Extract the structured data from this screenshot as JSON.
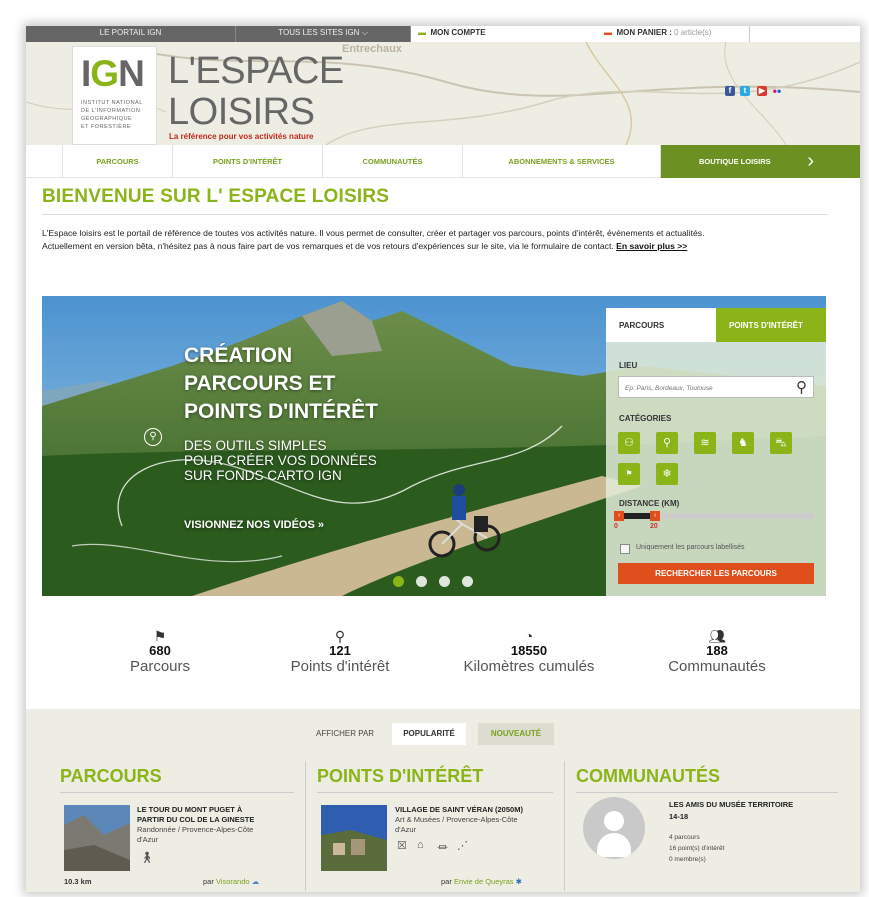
{
  "topbar": {
    "portail": "LE PORTAIL IGN",
    "sites": "TOUS LES SITES IGN",
    "compte": "MON COMPTE",
    "panier_label": "MON PANIER :",
    "panier_count": "0 article(s)"
  },
  "header": {
    "ign": "IGN",
    "institut": [
      "INSTITUT NATIONAL",
      "DE L'INFORMATION",
      "GÉOGRAPHIQUE",
      "ET FORESTIÈRE"
    ],
    "title_line1": "L'ESPACE",
    "title_line2": "LOISIRS",
    "tagline": "La référence pour vos activités nature",
    "map_place": "Entrechaux"
  },
  "nav": {
    "items": [
      "PARCOURS",
      "POINTS D'INTÉRÊT",
      "COMMUNAUTÉS",
      "ABONNEMENTS & SERVICES"
    ],
    "shop": "BOUTIQUE LOISIRS"
  },
  "welcome": "BIENVENUE SUR L' ESPACE LOISIRS",
  "intro": {
    "line1": "L'Espace loisirs est le portail de référence de toutes vos activités nature. Il vous permet de consulter, créer et partager vos parcours, points d'intérêt, événements et actualités.",
    "line2": "Actuellement en version bêta, n'hésitez pas à nous faire part de vos remarques et de vos retours d'expériences sur le site, via le formulaire de contact.",
    "link": "En savoir plus >>"
  },
  "hero": {
    "title": [
      "CRÉATION",
      "PARCOURS ET",
      "POINTS D'INTÉRÊT"
    ],
    "subtitle": [
      "DES OUTILS SIMPLES",
      "POUR CRÉER VOS DONNÉES",
      "SUR FONDS CARTO IGN"
    ],
    "video": "VISIONNEZ NOS VIDÉOS »"
  },
  "search": {
    "tab_parcours": "PARCOURS",
    "tab_points": "POINTS D'INTÉRÊT",
    "lieu": "LIEU",
    "placeholder": "Ep: Paris, Bordeaux, Toulouse",
    "categories": "CATÉGORIES",
    "distance": "DISTANCE (KM)",
    "min": "0",
    "max": "20",
    "labellises": "Uniquement les parcours labellisés",
    "button": "RECHERCHER LES PARCOURS"
  },
  "stats": [
    {
      "num": "680",
      "label": "Parcours"
    },
    {
      "num": "121",
      "label": "Points d'intérêt"
    },
    {
      "num": "18550",
      "label": "Kilomètres cumulés"
    },
    {
      "num": "188",
      "label": "Communautés"
    }
  ],
  "sort": {
    "label": "AFFICHER PAR",
    "popularite": "POPULARITÉ",
    "nouveaute": "NOUVEAUTÉ"
  },
  "columns": {
    "parcours": {
      "title": "PARCOURS",
      "item_title": [
        "LE TOUR DU MONT PUGET À",
        "PARTIR DU COL DE LA GINESTE"
      ],
      "meta": [
        "Randonnée / Provence-Alpes-Côte",
        "d'Azur"
      ],
      "distance": "10.3 km",
      "par": "par",
      "author": "Visorando"
    },
    "points": {
      "title": "POINTS D'INTÉRÊT",
      "item_title": "VILLAGE DE SAINT VÉRAN (2050M)",
      "meta": [
        "Art & Musées / Provence-Alpes-Côte",
        "d'Azur"
      ],
      "par": "par",
      "author": "Envie de Queyras"
    },
    "communautes": {
      "title": "COMMUNAUTÉS",
      "item_title": [
        "LES AMIS DU MUSÉE TERRITOIRE",
        "14-18"
      ],
      "meta": [
        "4 parcours",
        "16 point(s) d'intérêt",
        "0 membre(s)"
      ]
    }
  },
  "colors": {
    "green": "#8ab418",
    "dark_green": "#6c9022",
    "orange": "#e04e1b"
  }
}
